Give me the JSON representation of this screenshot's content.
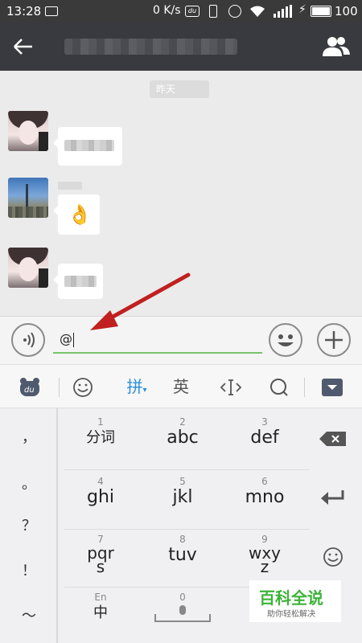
{
  "status_bar": {
    "time": "13:28",
    "net_speed": "0 K/s",
    "battery_pct": "100",
    "charging_symbol": "⚡",
    "app_icon_text": "du"
  },
  "app_bar": {
    "back_icon": "arrow-left-icon",
    "title_blurred": true,
    "group_icon": "group-members-icon"
  },
  "chat": {
    "timestamp": "昨天",
    "messages": [
      {
        "sender": "user-1",
        "type": "text",
        "blurred": true
      },
      {
        "sender": "user-2",
        "type": "emoji",
        "emoji": "👌"
      },
      {
        "sender": "user-1",
        "type": "text",
        "blurred": true
      }
    ]
  },
  "input_bar": {
    "voice_icon": "voice-input-icon",
    "text": "@",
    "emoji_icon": "smiley-icon",
    "plus_icon": "plus-icon"
  },
  "keyboard_toolbar": {
    "logo_text": "du",
    "items": [
      "emoji-face-icon",
      "拼",
      "英",
      "cursor-move-icon",
      "search-icon",
      "collapse-keyboard-icon"
    ],
    "pinyin_label": "拼",
    "english_label": "英"
  },
  "keyboard": {
    "side_keys": [
      "，",
      "。",
      "？",
      "！",
      "～"
    ],
    "keys": [
      {
        "num": "1",
        "label": "分词"
      },
      {
        "num": "2",
        "label": "abc"
      },
      {
        "num": "3",
        "label": "def"
      },
      {
        "num": "4",
        "label": "ghi"
      },
      {
        "num": "5",
        "label": "jkl"
      },
      {
        "num": "6",
        "label": "mno"
      },
      {
        "num": "7",
        "label_line1": "pqr",
        "label_line2": "s"
      },
      {
        "num": "8",
        "label": "tuv"
      },
      {
        "num": "9",
        "label_line1": "wxy",
        "label_line2": "z"
      }
    ],
    "bottom": {
      "lang_small": "En",
      "lang_label": "中",
      "space_num": "0"
    },
    "right_keys": [
      "backspace-icon",
      "enter-icon",
      "emoji-face-icon"
    ]
  },
  "watermark": {
    "title": "百科全说",
    "subtitle": "助你轻松解决"
  },
  "colors": {
    "accent_green": "#79c36d",
    "annotation_arrow": "#c0201f",
    "watermark_green": "#3db339"
  }
}
